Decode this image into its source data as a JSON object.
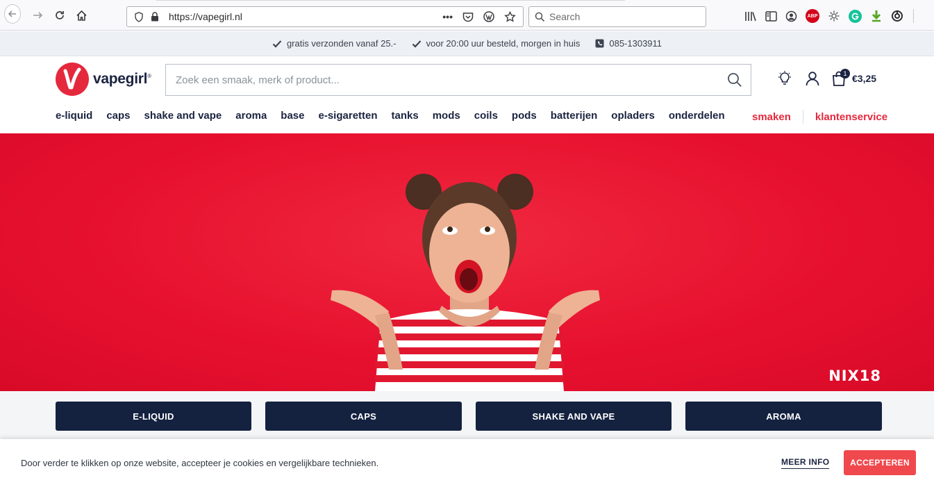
{
  "browser": {
    "url": "https://vapegirl.nl",
    "search_placeholder": "Search",
    "page_actions_label": "•••",
    "extension_abp_label": "ABP"
  },
  "usp": {
    "items": [
      "gratis verzonden vanaf 25.-",
      "voor 20:00 uur besteld, morgen in huis",
      "085-1303911"
    ]
  },
  "header": {
    "logo_text": "vapegirl",
    "logo_mark": "®",
    "search_placeholder": "Zoek een smaak, merk of product...",
    "cart_count": "1",
    "cart_total": "€3,25"
  },
  "nav": {
    "items": [
      "e-liquid",
      "caps",
      "shake and vape",
      "aroma",
      "base",
      "e-sigaretten",
      "tanks",
      "mods",
      "coils",
      "pods",
      "batterijen",
      "opladers",
      "onderdelen"
    ],
    "side": [
      "smaken",
      "klantenservice"
    ],
    "accent": "#e5293d"
  },
  "hero": {
    "badge": "NIX18",
    "background": "#e7112f"
  },
  "categories": [
    "E-LIQUID",
    "CAPS",
    "SHAKE AND VAPE",
    "AROMA"
  ],
  "cookie": {
    "text": "Door verder te klikken op onze website, accepteer je cookies en vergelijkbare technieken.",
    "more_label": "MEER INFO",
    "accept_label": "ACCEPTEREN",
    "accept_color": "#f0494d"
  }
}
